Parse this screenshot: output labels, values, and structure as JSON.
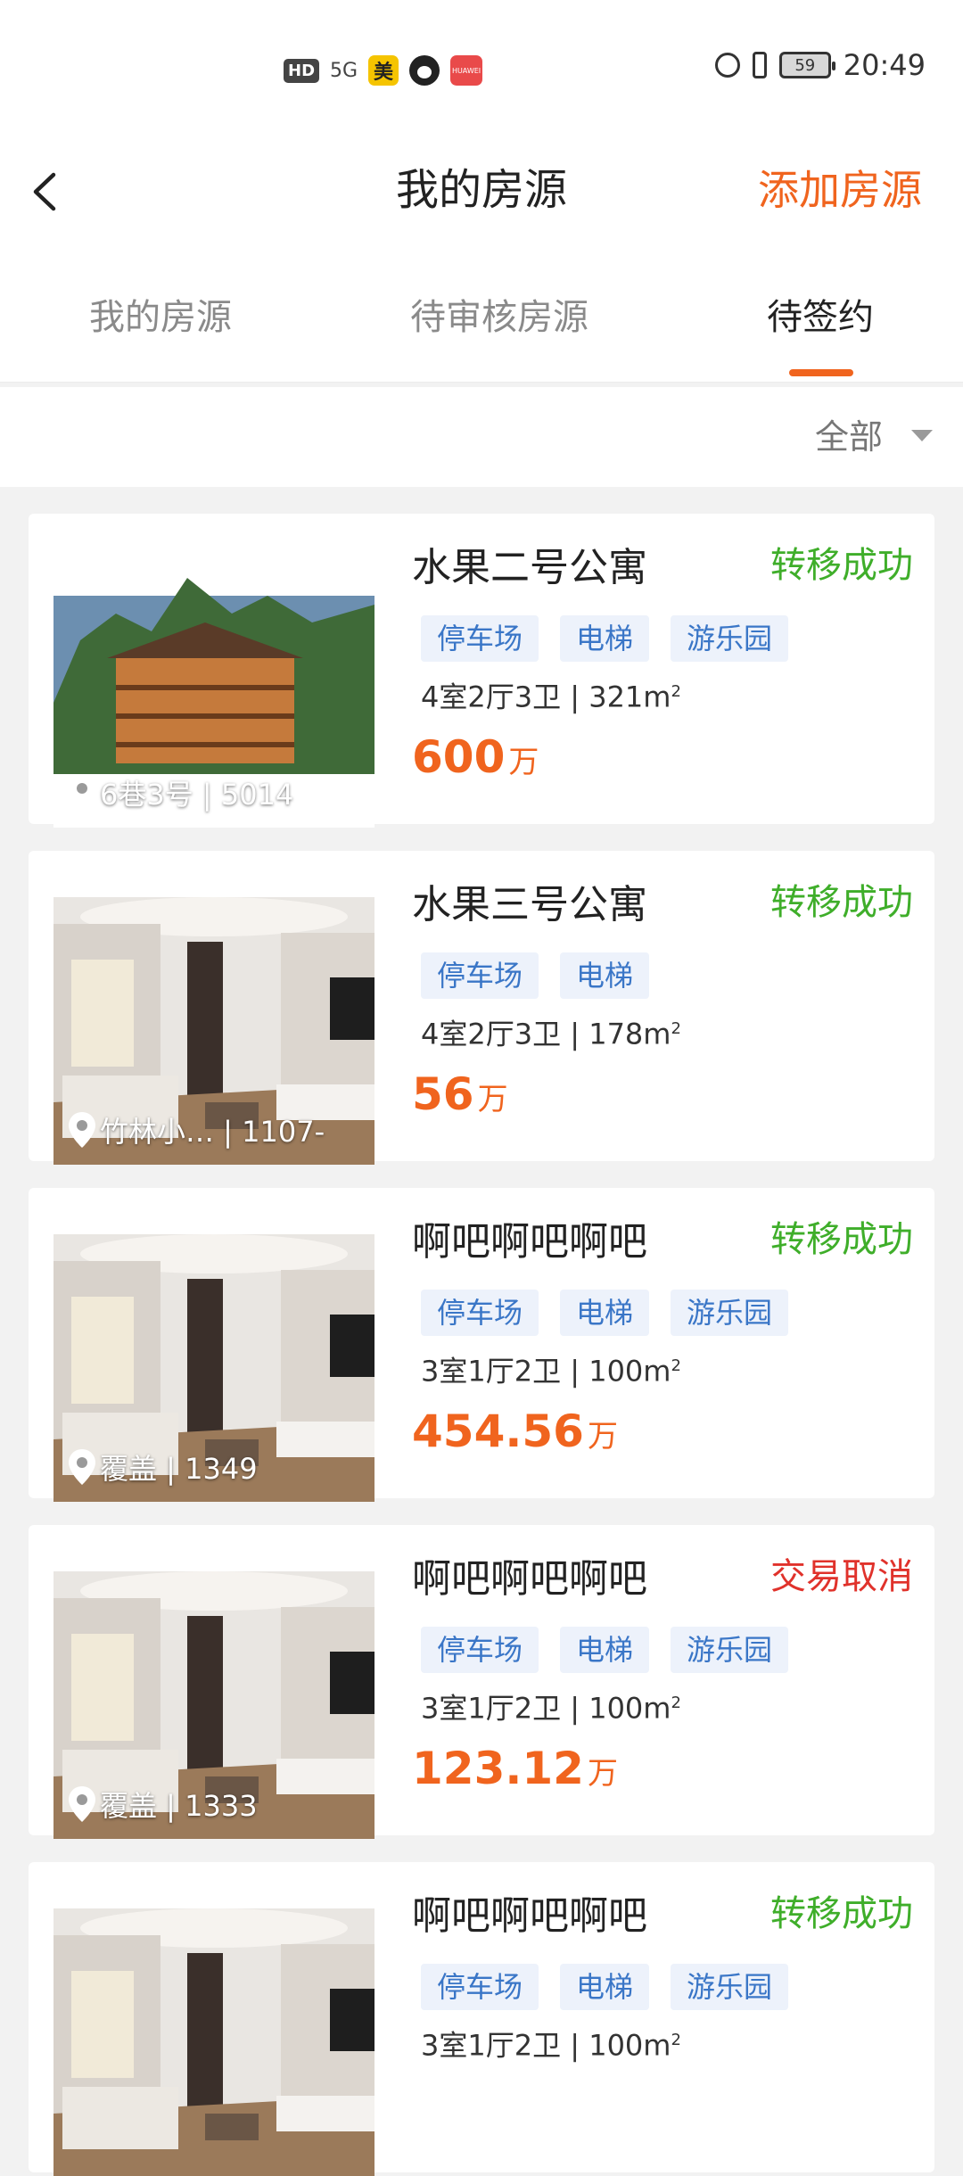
{
  "status_bar": {
    "hd": "HD",
    "signal": "5G",
    "app_meituan": "美",
    "app_huawei": "HUAWEI",
    "battery": "59",
    "time": "20:49"
  },
  "nav": {
    "title": "我的房源",
    "add_label": "添加房源"
  },
  "tabs": [
    {
      "label": "我的房源",
      "active": false
    },
    {
      "label": "待审核房源",
      "active": false
    },
    {
      "label": "待签约",
      "active": true
    }
  ],
  "filter": {
    "label": "全部"
  },
  "colors": {
    "accent": "#f0641e",
    "success": "#3fae2a",
    "cancel": "#e0322b",
    "tag_text": "#3a76c7",
    "tag_bg": "#edf2fb"
  },
  "listings": [
    {
      "title": "水果二号公寓",
      "status": "转移成功",
      "status_type": "success",
      "tags": [
        "停车场",
        "电梯",
        "游乐园"
      ],
      "specs": "4室2厅3卫 | 321m",
      "specs_unit_sup": "2",
      "price": "600",
      "price_unit": "万",
      "location": "6巷3号 | 5014",
      "image": "house-icon"
    },
    {
      "title": "水果三号公寓",
      "status": "转移成功",
      "status_type": "success",
      "tags": [
        "停车场",
        "电梯"
      ],
      "specs": "4室2厅3卫 | 178m",
      "specs_unit_sup": "2",
      "price": "56",
      "price_unit": "万",
      "location": "竹林小… | 1107-",
      "image": "interior-icon"
    },
    {
      "title": "啊吧啊吧啊吧",
      "status": "转移成功",
      "status_type": "success",
      "tags": [
        "停车场",
        "电梯",
        "游乐园"
      ],
      "specs": "3室1厅2卫 | 100m",
      "specs_unit_sup": "2",
      "price": "454.56",
      "price_unit": "万",
      "location": "覆盖 | 1349",
      "image": "interior-icon"
    },
    {
      "title": "啊吧啊吧啊吧",
      "status": "交易取消",
      "status_type": "cancel",
      "tags": [
        "停车场",
        "电梯",
        "游乐园"
      ],
      "specs": "3室1厅2卫 | 100m",
      "specs_unit_sup": "2",
      "price": "123.12",
      "price_unit": "万",
      "location": "覆盖 | 1333",
      "image": "interior-icon"
    },
    {
      "title": "啊吧啊吧啊吧",
      "status": "转移成功",
      "status_type": "success",
      "tags": [
        "停车场",
        "电梯",
        "游乐园"
      ],
      "specs": "3室1厅2卫 | 100m",
      "specs_unit_sup": "2",
      "price": "",
      "price_unit": "",
      "location": "",
      "image": "interior-icon"
    }
  ]
}
